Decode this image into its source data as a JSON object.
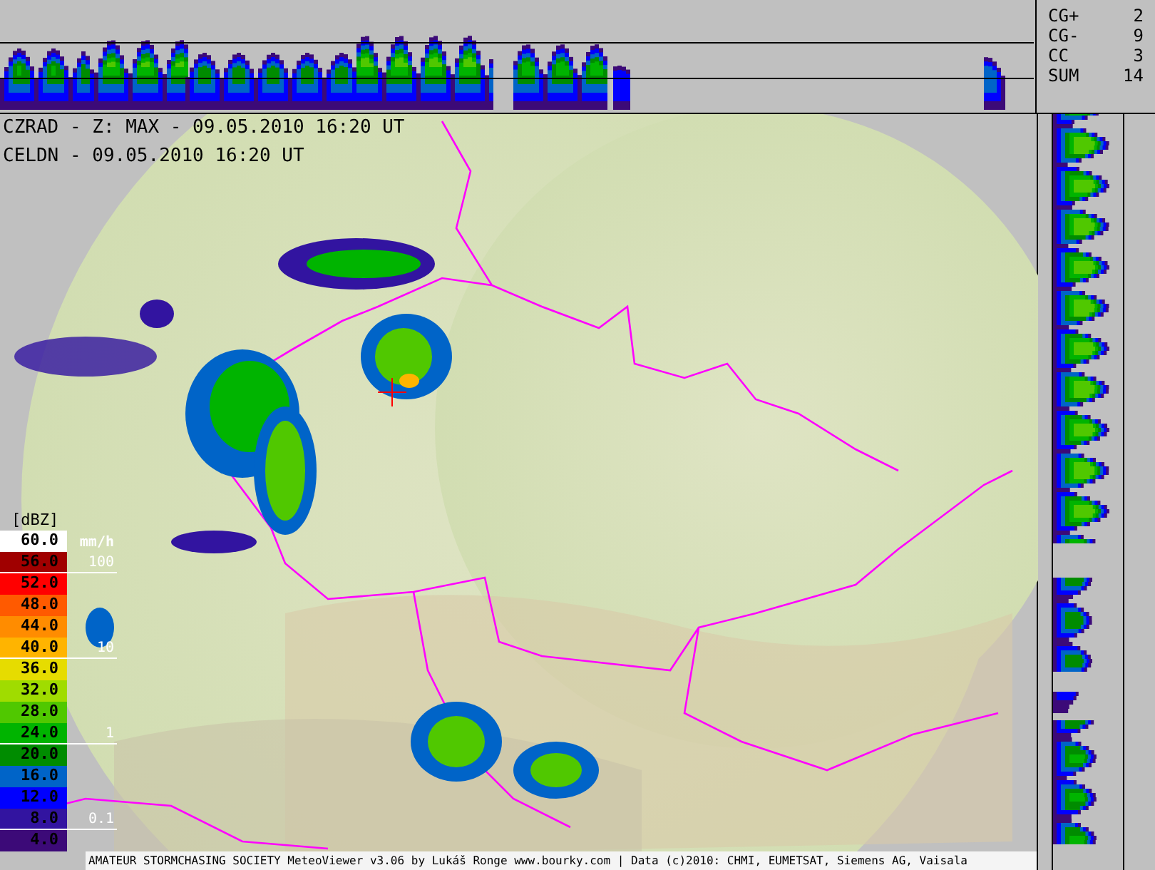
{
  "stats": [
    {
      "label": "CG+",
      "value": "2"
    },
    {
      "label": "CG-",
      "value": "9"
    },
    {
      "label": "CC",
      "value": "3"
    },
    {
      "label": "SUM",
      "value": "14"
    }
  ],
  "titles": [
    "CZRAD - Z: MAX - 09.05.2010 16:20 UT",
    "CELDN - 09.05.2010 16:20 UT"
  ],
  "legend": {
    "unit": "[dBZ]",
    "rows": [
      {
        "label": "60.0",
        "color": "#ffffff",
        "rate_unit": "mm/h"
      },
      {
        "label": "56.0",
        "color": "#a00000",
        "rate_tick": "100"
      },
      {
        "label": "52.0",
        "color": "#ff0000"
      },
      {
        "label": "48.0",
        "color": "#ff5a00"
      },
      {
        "label": "44.0",
        "color": "#ff8c00"
      },
      {
        "label": "40.0",
        "color": "#ffb400",
        "rate_tick": "10"
      },
      {
        "label": "36.0",
        "color": "#e6dc00"
      },
      {
        "label": "32.0",
        "color": "#a0dc00"
      },
      {
        "label": "28.0",
        "color": "#50c800"
      },
      {
        "label": "24.0",
        "color": "#00b400",
        "rate_tick": "1"
      },
      {
        "label": "20.0",
        "color": "#008c00"
      },
      {
        "label": "16.0",
        "color": "#0064c8"
      },
      {
        "label": "12.0",
        "color": "#0000ff"
      },
      {
        "label": "8.0",
        "color": "#3214a0",
        "rate_tick": "0.1"
      },
      {
        "label": "4.0",
        "color": "#3c0a78"
      }
    ]
  },
  "footer": "AMATEUR STORMCHASING SOCIETY MeteoViewer v3.06 by Lukáš Ronge www.bourky.com | Data (c)2010: CHMI, EUMETSAT, Siemens AG, Vaisala"
}
